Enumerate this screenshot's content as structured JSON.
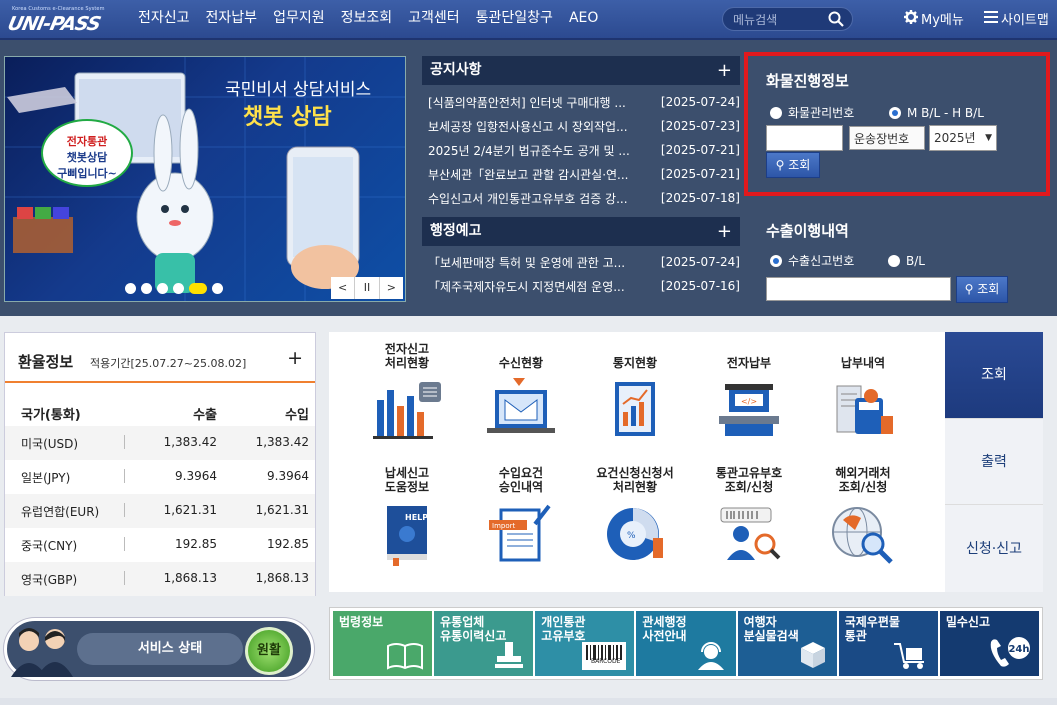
{
  "header": {
    "logo_sub": "Korea Customs e-Clearance System",
    "logo_main": "UNI-PASS",
    "nav": [
      "전자신고",
      "전자납부",
      "업무지원",
      "정보조회",
      "고객센터",
      "통관단일창구",
      "AEO"
    ],
    "menu_search_placeholder": "메뉴검색",
    "my_menu": "My메뉴",
    "sitemap": "사이트맵"
  },
  "banner": {
    "title": "국민비서 상담서비스",
    "highlight": "챗봇 상담",
    "bubble": [
      "전자통관",
      "챗봇상담",
      "구삐입니다~"
    ],
    "controls": [
      "<",
      "II",
      ">"
    ]
  },
  "notice": {
    "title": "공지사항",
    "plus": "+",
    "items": [
      {
        "title": "[식품의약품안전처] 인터넷 구매대행 ...",
        "date": "[2025-07-24]"
      },
      {
        "title": "보세공장 입항전사용신고 시 장외작업...",
        "date": "[2025-07-23]"
      },
      {
        "title": "2025년 2/4분기 법규준수도 공개 및 ...",
        "date": "[2025-07-21]"
      },
      {
        "title": "부산세관「완료보고 관할 감시관실·연...",
        "date": "[2025-07-21]"
      },
      {
        "title": "수입신고서 개인통관고유부호 검증 강...",
        "date": "[2025-07-18]"
      }
    ]
  },
  "admin_notice": {
    "title": "행정예고",
    "plus": "+",
    "items": [
      {
        "title": "「보세판매장 특허 및 운영에 관한 고...",
        "date": "[2025-07-24]"
      },
      {
        "title": "「제주국제자유도시 지정면세점 운영...",
        "date": "[2025-07-16]"
      }
    ]
  },
  "cargo": {
    "title": "화물진행정보",
    "radio1": "화물관리번호",
    "radio2": "M B/L - H B/L",
    "input_value": "",
    "bl_value": "운송장번호",
    "year": "2025년",
    "search": "조회"
  },
  "export": {
    "title": "수출이행내역",
    "radio1": "수출신고번호",
    "radio2": "B/L",
    "search": "조회"
  },
  "rate": {
    "title": "환율정보",
    "period": "적용기간[25.07.27~25.08.02]",
    "plus": "+",
    "headers": [
      "국가(통화)",
      "수출",
      "수입"
    ],
    "rows": [
      {
        "country": "미국(USD)",
        "export": "1,383.42",
        "import": "1,383.42"
      },
      {
        "country": "일본(JPY)",
        "export": "9.3964",
        "import": "9.3964"
      },
      {
        "country": "유럽연합(EUR)",
        "export": "1,621.31",
        "import": "1,621.31"
      },
      {
        "country": "중국(CNY)",
        "export": "192.85",
        "import": "192.85"
      },
      {
        "country": "영국(GBP)",
        "export": "1,868.13",
        "import": "1,868.13"
      }
    ]
  },
  "services": {
    "row1": [
      {
        "l1": "전자신고",
        "l2": "처리현황",
        "icon": "bar-chart-icon"
      },
      {
        "l1": "",
        "l2": "수신현황",
        "icon": "envelope-monitor-icon"
      },
      {
        "l1": "",
        "l2": "통지현황",
        "icon": "report-icon"
      },
      {
        "l1": "",
        "l2": "전자납부",
        "icon": "payment-terminal-icon"
      },
      {
        "l1": "",
        "l2": "납부내역",
        "icon": "receipt-calculator-icon"
      }
    ],
    "row2": [
      {
        "l1": "납세신고",
        "l2": "도움정보",
        "icon": "help-book-icon"
      },
      {
        "l1": "수입요건",
        "l2": "승인내역",
        "icon": "import-document-icon"
      },
      {
        "l1": "요건신청신청서",
        "l2": "처리현황",
        "icon": "percent-chart-icon"
      },
      {
        "l1": "통관고유부호",
        "l2": "조회/신청",
        "icon": "person-search-icon"
      },
      {
        "l1": "해외거래처",
        "l2": "조회/신청",
        "icon": "globe-search-icon"
      }
    ]
  },
  "tabs": [
    "조회",
    "출력",
    "신청·신고"
  ],
  "status": {
    "label": "서비스 상태",
    "value": "원활"
  },
  "quick": [
    {
      "l1": "법령정보",
      "l2": "",
      "color": "#4aa86a",
      "icon": "book-icon"
    },
    {
      "l1": "유통업체",
      "l2": "유통이력신고",
      "color": "#3b9a8e",
      "icon": "stamp-icon"
    },
    {
      "l1": "개인통관",
      "l2": "고유부호",
      "color": "#2e8fa6",
      "icon": "barcode-icon"
    },
    {
      "l1": "관세행정",
      "l2": "사전안내",
      "color": "#1e7aa0",
      "icon": "headset-icon"
    },
    {
      "l1": "여행자",
      "l2": "분실물검색",
      "color": "#1d5e94",
      "icon": "box-icon"
    },
    {
      "l1": "국제우편물",
      "l2": "통관",
      "color": "#1a4a85",
      "icon": "cart-icon"
    },
    {
      "l1": "밀수신고",
      "l2": "",
      "color": "#143a70",
      "icon": "phone-24h-icon"
    }
  ],
  "barcode_text": "BARCODE",
  "colors": {
    "header": "#2c4a90",
    "hero": "#3c4f6d",
    "highlight_border": "#e1191d",
    "accent": "#f08030"
  }
}
